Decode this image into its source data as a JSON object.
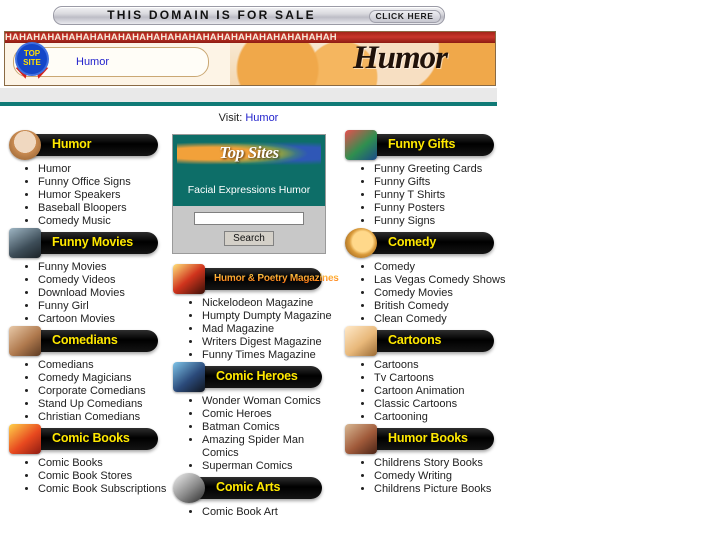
{
  "top_bar": {
    "headline": "THIS DOMAIN IS FOR SALE",
    "cta": "CLICK HERE"
  },
  "site_banner": {
    "haha_strip": "HAHAHAHAHAHAHAHAHAHAHAHAHAHAHAHAHAHAHAHAHAHAHAH",
    "wordmark": "Humor",
    "badge_line1": "TOP",
    "badge_line2": "SITE",
    "pill_label": "Humor"
  },
  "visit": {
    "prefix": "Visit:",
    "link": "Humor"
  },
  "topsites": {
    "logo_text": "Top Sites",
    "subtitle": "Facial Expressions Humor",
    "search_value": "",
    "search_placeholder": "",
    "search_button": "Search"
  },
  "columns": {
    "left": [
      {
        "title": "Humor",
        "icon": "old-man-photo-icon",
        "style": "yellow",
        "items": [
          "Humor",
          "Funny Office Signs",
          "Humor Speakers",
          "Baseball Bloopers",
          "Comedy Music"
        ]
      },
      {
        "title": "Funny Movies",
        "icon": "laurel-hardy-photo-icon",
        "style": "yellow",
        "items": [
          "Funny Movies",
          "Comedy Videos",
          "Download Movies",
          "Funny Girl",
          "Cartoon Movies"
        ]
      },
      {
        "title": "Comedians",
        "icon": "comedians-photo-icon",
        "style": "yellow",
        "items": [
          "Comedians",
          "Comedy Magicians",
          "Corporate Comedians",
          "Stand Up Comedians",
          "Christian Comedians"
        ]
      },
      {
        "title": "Comic Books",
        "icon": "comic-books-photo-icon",
        "style": "yellow",
        "items": [
          "Comic Books",
          "Comic Book Stores",
          "Comic Book Subscriptions"
        ]
      }
    ],
    "center": [
      {
        "title": "Humor & Poetry Magazines",
        "icon": "magazines-photo-icon",
        "style": "warm",
        "items": [
          "Nickelodeon Magazine",
          "Humpty Dumpty Magazine",
          "Mad Magazine",
          "Writers Digest Magazine",
          "Funny Times Magazine"
        ]
      },
      {
        "title": "Comic Heroes",
        "icon": "comic-heroes-photo-icon",
        "style": "yellow",
        "items": [
          "Wonder Woman Comics",
          "Comic Heroes",
          "Batman Comics",
          "Amazing Spider Man Comics",
          "Superman Comics"
        ]
      },
      {
        "title": "Comic Arts",
        "icon": "comic-arts-photo-icon",
        "style": "yellow",
        "items": [
          "Comic Book Art"
        ]
      }
    ],
    "right": [
      {
        "title": "Funny Gifts",
        "icon": "gift-boxes-photo-icon",
        "style": "yellow",
        "items": [
          "Funny Greeting Cards",
          "Funny Gifts",
          "Funny T Shirts",
          "Funny Posters",
          "Funny Signs"
        ]
      },
      {
        "title": "Comedy",
        "icon": "comedy-mask-photo-icon",
        "style": "yellow",
        "items": [
          "Comedy",
          "Las Vegas Comedy Shows",
          "Comedy Movies",
          "British Comedy",
          "Clean Comedy"
        ]
      },
      {
        "title": "Cartoons",
        "icon": "cartoon-character-photo-icon",
        "style": "yellow",
        "items": [
          "Cartoons",
          "Tv Cartoons",
          "Cartoon Animation",
          "Classic Cartoons",
          "Cartooning"
        ]
      },
      {
        "title": "Humor Books",
        "icon": "book-stack-photo-icon",
        "style": "yellow",
        "items": [
          "Childrens Story Books",
          "Comedy Writing",
          "Childrens Picture Books"
        ]
      }
    ]
  },
  "colors": {
    "teal_rule": "#0f7a76",
    "pill_bg": "#000000",
    "pill_text": "#ffe800",
    "link": "#2222cc",
    "haha_red": "#c8362a"
  }
}
